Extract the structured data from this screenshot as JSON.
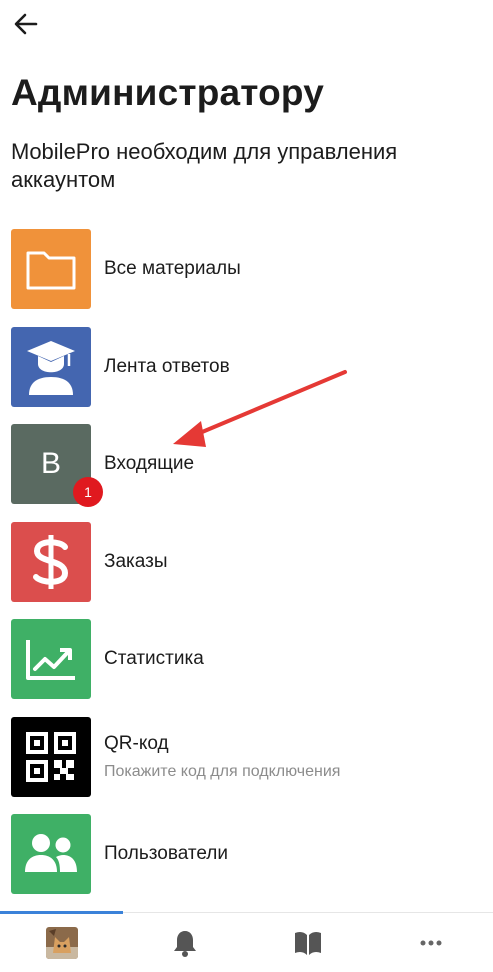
{
  "header": {
    "back_icon": "arrow-left-icon",
    "title": "Администратору",
    "subtitle": "MobilePro необходим для управления аккаунтом"
  },
  "menu": {
    "items": [
      {
        "label": "Все материалы",
        "icon": "folder-icon",
        "color": "#f0923a"
      },
      {
        "label": "Лента ответов",
        "icon": "graduate-icon",
        "color": "#4466b0"
      },
      {
        "label": "Входящие",
        "icon": "letter-b",
        "tile_text": "B",
        "color": "#5a6a61",
        "badge": "1"
      },
      {
        "label": "Заказы",
        "icon": "dollar-icon",
        "color": "#db4e4d"
      },
      {
        "label": "Статистика",
        "icon": "chart-trend-icon",
        "color": "#3fb066"
      },
      {
        "label": "QR-код",
        "sublabel": "Покажите код для подключения",
        "icon": "qr-code-icon",
        "color": "#000000"
      },
      {
        "label": "Пользователи",
        "icon": "users-icon",
        "color": "#3fb066"
      }
    ]
  },
  "tabbar": {
    "tabs": [
      "avatar",
      "bell-icon",
      "book-icon",
      "more-icon"
    ],
    "active_index": 0,
    "accent": "#3b82d9"
  },
  "annotation": {
    "arrow_color": "#e53935"
  }
}
